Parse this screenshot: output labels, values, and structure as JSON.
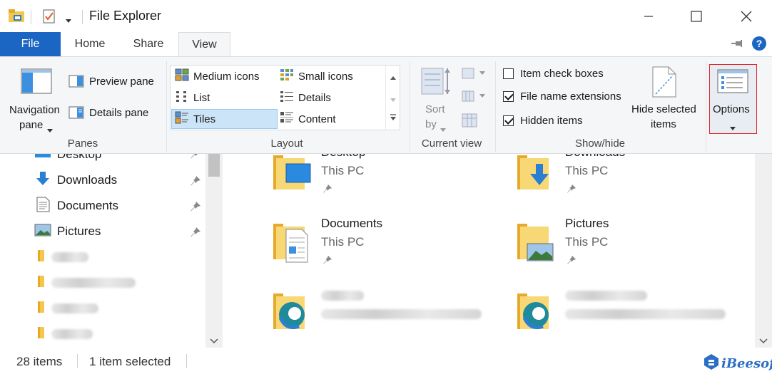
{
  "window": {
    "title": "File Explorer"
  },
  "tabs": [
    {
      "label": "File"
    },
    {
      "label": "Home"
    },
    {
      "label": "Share"
    },
    {
      "label": "View"
    }
  ],
  "ribbon": {
    "panes": {
      "navigation_pane_line1": "Navigation",
      "navigation_pane_line2": "pane",
      "preview_pane": "Preview pane",
      "details_pane": "Details pane",
      "group_label": "Panes"
    },
    "layout": {
      "items": [
        "Medium icons",
        "Small icons",
        "List",
        "Details",
        "Tiles",
        "Content"
      ],
      "selected": "Tiles",
      "group_label": "Layout"
    },
    "current_view": {
      "sort_line1": "Sort",
      "sort_line2": "by",
      "group_label": "Current view"
    },
    "show_hide": {
      "item_check_boxes": {
        "label": "Item check boxes",
        "checked": false
      },
      "file_name_extensions": {
        "label": "File name extensions",
        "checked": true
      },
      "hidden_items": {
        "label": "Hidden items",
        "checked": true
      },
      "hide_selected_line1": "Hide selected",
      "hide_selected_line2": "items",
      "group_label": "Show/hide"
    },
    "options": {
      "label": "Options"
    }
  },
  "nav_pane": {
    "items": [
      {
        "label": "Desktop",
        "icon": "desktop-icon",
        "pinned": true
      },
      {
        "label": "Downloads",
        "icon": "download-arrow-icon",
        "pinned": true
      },
      {
        "label": "Documents",
        "icon": "documents-icon",
        "pinned": true
      },
      {
        "label": "Pictures",
        "icon": "pictures-icon",
        "pinned": true
      },
      {
        "label": "",
        "icon": "folder-icon",
        "pinned": false
      },
      {
        "label": "",
        "icon": "folder-icon",
        "pinned": false
      },
      {
        "label": "",
        "icon": "folder-icon",
        "pinned": false
      },
      {
        "label": "",
        "icon": "folder-icon",
        "pinned": false
      }
    ]
  },
  "content": {
    "tiles": [
      {
        "name": "Desktop",
        "sub": "This PC",
        "icon": "desktop-folder-icon"
      },
      {
        "name": "Downloads",
        "sub": "This PC",
        "icon": "downloads-folder-icon"
      },
      {
        "name": "Documents",
        "sub": "This PC",
        "icon": "documents-folder-icon"
      },
      {
        "name": "Pictures",
        "sub": "This PC",
        "icon": "pictures-folder-icon"
      },
      {
        "name": "",
        "sub": "",
        "icon": "edge-folder-icon"
      },
      {
        "name": "",
        "sub": "",
        "icon": "edge-folder-icon"
      }
    ]
  },
  "status": {
    "item_count": "28 items",
    "selection": "1 item selected"
  },
  "watermark": {
    "brand": "iBeesoft"
  },
  "colors": {
    "accent": "#1a66c2",
    "ribbon_bg": "#f5f6f7",
    "selected_bg": "#cce4f7",
    "options_outline": "#e2232a",
    "folder_yellow": "#f8d775"
  }
}
